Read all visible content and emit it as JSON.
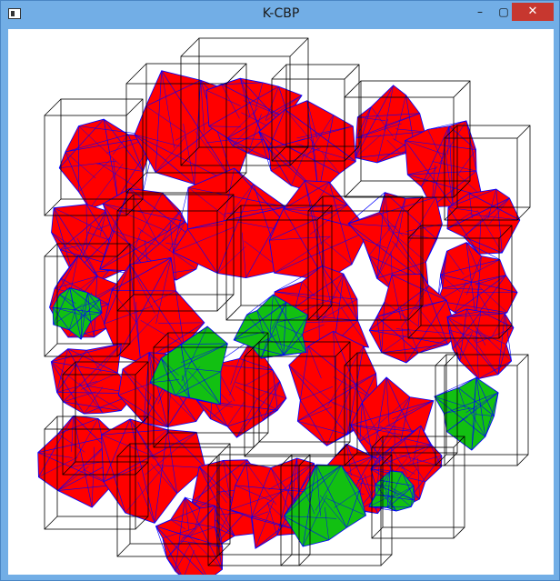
{
  "window": {
    "title": "K-CBP",
    "icon": "app-window-icon",
    "controls": {
      "minimize": "minimize-icon",
      "maximize": "maximize-icon",
      "close": "close-icon",
      "minimize_glyph": "–",
      "maximize_glyph": "▢",
      "close_glyph": "✕"
    }
  },
  "scene": {
    "background": "#ffffff",
    "polyhedron_fill_default": "#ff0000",
    "polyhedron_fill_highlight": "#12c012",
    "mesh_edge_color": "#0000ff",
    "bounding_box_color": "#000000"
  }
}
